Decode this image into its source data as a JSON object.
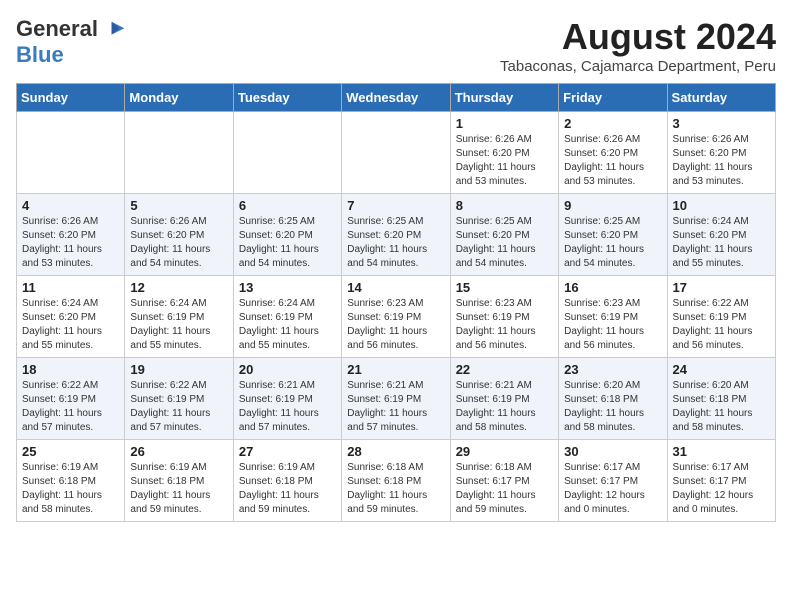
{
  "logo": {
    "general": "General",
    "blue": "Blue"
  },
  "title": {
    "month_year": "August 2024",
    "location": "Tabaconas, Cajamarca Department, Peru"
  },
  "weekdays": [
    "Sunday",
    "Monday",
    "Tuesday",
    "Wednesday",
    "Thursday",
    "Friday",
    "Saturday"
  ],
  "weeks": [
    [
      {
        "day": "",
        "info": ""
      },
      {
        "day": "",
        "info": ""
      },
      {
        "day": "",
        "info": ""
      },
      {
        "day": "",
        "info": ""
      },
      {
        "day": "1",
        "info": "Sunrise: 6:26 AM\nSunset: 6:20 PM\nDaylight: 11 hours\nand 53 minutes."
      },
      {
        "day": "2",
        "info": "Sunrise: 6:26 AM\nSunset: 6:20 PM\nDaylight: 11 hours\nand 53 minutes."
      },
      {
        "day": "3",
        "info": "Sunrise: 6:26 AM\nSunset: 6:20 PM\nDaylight: 11 hours\nand 53 minutes."
      }
    ],
    [
      {
        "day": "4",
        "info": "Sunrise: 6:26 AM\nSunset: 6:20 PM\nDaylight: 11 hours\nand 53 minutes."
      },
      {
        "day": "5",
        "info": "Sunrise: 6:26 AM\nSunset: 6:20 PM\nDaylight: 11 hours\nand 54 minutes."
      },
      {
        "day": "6",
        "info": "Sunrise: 6:25 AM\nSunset: 6:20 PM\nDaylight: 11 hours\nand 54 minutes."
      },
      {
        "day": "7",
        "info": "Sunrise: 6:25 AM\nSunset: 6:20 PM\nDaylight: 11 hours\nand 54 minutes."
      },
      {
        "day": "8",
        "info": "Sunrise: 6:25 AM\nSunset: 6:20 PM\nDaylight: 11 hours\nand 54 minutes."
      },
      {
        "day": "9",
        "info": "Sunrise: 6:25 AM\nSunset: 6:20 PM\nDaylight: 11 hours\nand 54 minutes."
      },
      {
        "day": "10",
        "info": "Sunrise: 6:24 AM\nSunset: 6:20 PM\nDaylight: 11 hours\nand 55 minutes."
      }
    ],
    [
      {
        "day": "11",
        "info": "Sunrise: 6:24 AM\nSunset: 6:20 PM\nDaylight: 11 hours\nand 55 minutes."
      },
      {
        "day": "12",
        "info": "Sunrise: 6:24 AM\nSunset: 6:19 PM\nDaylight: 11 hours\nand 55 minutes."
      },
      {
        "day": "13",
        "info": "Sunrise: 6:24 AM\nSunset: 6:19 PM\nDaylight: 11 hours\nand 55 minutes."
      },
      {
        "day": "14",
        "info": "Sunrise: 6:23 AM\nSunset: 6:19 PM\nDaylight: 11 hours\nand 56 minutes."
      },
      {
        "day": "15",
        "info": "Sunrise: 6:23 AM\nSunset: 6:19 PM\nDaylight: 11 hours\nand 56 minutes."
      },
      {
        "day": "16",
        "info": "Sunrise: 6:23 AM\nSunset: 6:19 PM\nDaylight: 11 hours\nand 56 minutes."
      },
      {
        "day": "17",
        "info": "Sunrise: 6:22 AM\nSunset: 6:19 PM\nDaylight: 11 hours\nand 56 minutes."
      }
    ],
    [
      {
        "day": "18",
        "info": "Sunrise: 6:22 AM\nSunset: 6:19 PM\nDaylight: 11 hours\nand 57 minutes."
      },
      {
        "day": "19",
        "info": "Sunrise: 6:22 AM\nSunset: 6:19 PM\nDaylight: 11 hours\nand 57 minutes."
      },
      {
        "day": "20",
        "info": "Sunrise: 6:21 AM\nSunset: 6:19 PM\nDaylight: 11 hours\nand 57 minutes."
      },
      {
        "day": "21",
        "info": "Sunrise: 6:21 AM\nSunset: 6:19 PM\nDaylight: 11 hours\nand 57 minutes."
      },
      {
        "day": "22",
        "info": "Sunrise: 6:21 AM\nSunset: 6:19 PM\nDaylight: 11 hours\nand 58 minutes."
      },
      {
        "day": "23",
        "info": "Sunrise: 6:20 AM\nSunset: 6:18 PM\nDaylight: 11 hours\nand 58 minutes."
      },
      {
        "day": "24",
        "info": "Sunrise: 6:20 AM\nSunset: 6:18 PM\nDaylight: 11 hours\nand 58 minutes."
      }
    ],
    [
      {
        "day": "25",
        "info": "Sunrise: 6:19 AM\nSunset: 6:18 PM\nDaylight: 11 hours\nand 58 minutes."
      },
      {
        "day": "26",
        "info": "Sunrise: 6:19 AM\nSunset: 6:18 PM\nDaylight: 11 hours\nand 59 minutes."
      },
      {
        "day": "27",
        "info": "Sunrise: 6:19 AM\nSunset: 6:18 PM\nDaylight: 11 hours\nand 59 minutes."
      },
      {
        "day": "28",
        "info": "Sunrise: 6:18 AM\nSunset: 6:18 PM\nDaylight: 11 hours\nand 59 minutes."
      },
      {
        "day": "29",
        "info": "Sunrise: 6:18 AM\nSunset: 6:17 PM\nDaylight: 11 hours\nand 59 minutes."
      },
      {
        "day": "30",
        "info": "Sunrise: 6:17 AM\nSunset: 6:17 PM\nDaylight: 12 hours\nand 0 minutes."
      },
      {
        "day": "31",
        "info": "Sunrise: 6:17 AM\nSunset: 6:17 PM\nDaylight: 12 hours\nand 0 minutes."
      }
    ]
  ]
}
